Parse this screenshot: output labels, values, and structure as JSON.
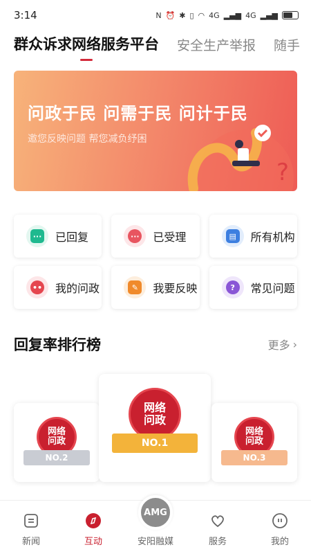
{
  "status": {
    "time": "3:14",
    "net1": "4G",
    "net2": "4G"
  },
  "tabs": [
    {
      "label": "群众诉求网络服务平台",
      "active": true
    },
    {
      "label": "安全生产举报",
      "active": false
    },
    {
      "label": "随手",
      "active": false
    }
  ],
  "banner": {
    "title": "问政于民 问需于民 问计于民",
    "subtitle": "邀您反映问题 帮您减负纾困"
  },
  "tiles": [
    {
      "label": "已回复",
      "icon": "chat-bubble-icon",
      "color": "#1fb98f"
    },
    {
      "label": "已受理",
      "icon": "message-dots-icon",
      "color": "#e85560"
    },
    {
      "label": "所有机构",
      "icon": "building-icon",
      "color": "#3d7fe0"
    },
    {
      "label": "我的问政",
      "icon": "user-face-icon",
      "color": "#e5464f"
    },
    {
      "label": "我要反映",
      "icon": "edit-document-icon",
      "color": "#f08a2b"
    },
    {
      "label": "常见问题",
      "icon": "question-icon",
      "color": "#8a56d6"
    }
  ],
  "ranking": {
    "title": "回复率排行榜",
    "more": "更多",
    "badge_text_top": "网络",
    "badge_text_bottom": "问政",
    "ranks": [
      "NO.1",
      "NO.2",
      "NO.3"
    ]
  },
  "nav": [
    {
      "label": "新闻",
      "icon": "news-icon"
    },
    {
      "label": "互动",
      "icon": "interact-icon",
      "active": true
    },
    {
      "label": "安阳融媒",
      "logo": "AMG"
    },
    {
      "label": "服务",
      "icon": "heart-icon"
    },
    {
      "label": "我的",
      "icon": "profile-icon"
    }
  ],
  "colors": {
    "accent": "#c9202f",
    "gold": "#f3b33a",
    "silver": "#c9ccd3",
    "bronze": "#f6b98e"
  }
}
